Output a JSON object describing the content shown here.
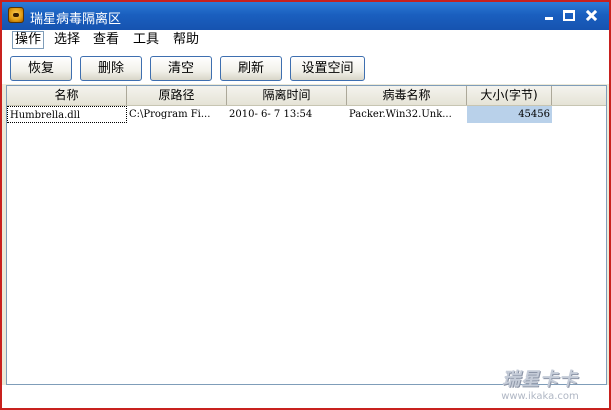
{
  "window": {
    "title": "瑞星病毒隔离区"
  },
  "menubar": {
    "items": [
      {
        "label": "操作"
      },
      {
        "label": "选择"
      },
      {
        "label": "查看"
      },
      {
        "label": "工具"
      },
      {
        "label": "帮助"
      }
    ]
  },
  "toolbar": {
    "restore_label": "恢复",
    "delete_label": "删除",
    "clear_label": "清空",
    "refresh_label": "刷新",
    "settings_label": "设置空间"
  },
  "table": {
    "columns": [
      "名称",
      "原路径",
      "隔离时间",
      "病毒名称",
      "大小(字节)"
    ],
    "rows": [
      {
        "name": "Humbrella.dll",
        "path": "C:\\Program Fi...",
        "time": "2010- 6- 7 13:54",
        "virus": "Packer.Win32.Unk...",
        "size": "45456"
      }
    ]
  },
  "watermark": {
    "logo": "瑞星卡卡",
    "url": "www.ikaka.com"
  },
  "colors": {
    "title_bar": "#1a5fbf",
    "selection": "#b9d1ea",
    "window_border": "#c8211e"
  }
}
